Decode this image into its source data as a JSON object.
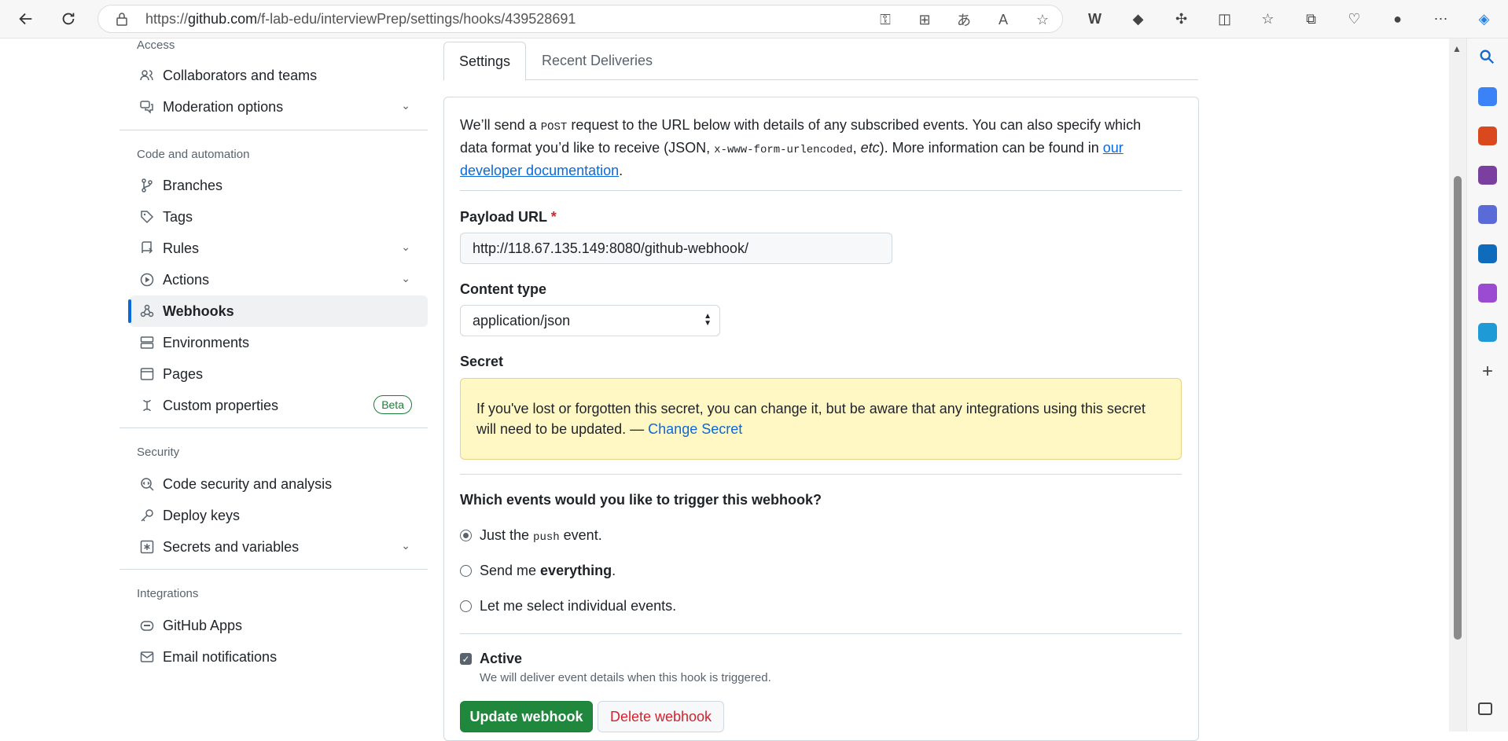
{
  "browser": {
    "url_prefix": "https://",
    "url_host": "github.com",
    "url_path": "/f-lab-edu/interviewPrep/settings/hooks/439528691"
  },
  "sidebar": {
    "access_heading": "Access",
    "access_items": [
      {
        "label": "Collaborators and teams",
        "icon": "people-icon"
      },
      {
        "label": "Moderation options",
        "icon": "comment-discussion-icon"
      }
    ],
    "code_heading": "Code and automation",
    "code_items": [
      {
        "label": "Branches",
        "icon": "git-branch-icon"
      },
      {
        "label": "Tags",
        "icon": "tag-icon"
      },
      {
        "label": "Rules",
        "icon": "repo-push-icon"
      },
      {
        "label": "Actions",
        "icon": "play-icon"
      },
      {
        "label": "Webhooks",
        "icon": "webhook-icon"
      },
      {
        "label": "Environments",
        "icon": "server-icon"
      },
      {
        "label": "Pages",
        "icon": "browser-icon"
      },
      {
        "label": "Custom properties",
        "icon": "note-icon",
        "badge": "Beta"
      }
    ],
    "security_heading": "Security",
    "security_items": [
      {
        "label": "Code security and analysis",
        "icon": "codescan-icon"
      },
      {
        "label": "Deploy keys",
        "icon": "key-icon"
      },
      {
        "label": "Secrets and variables",
        "icon": "key-asterisk-icon"
      }
    ],
    "integrations_heading": "Integrations",
    "integrations_items": [
      {
        "label": "GitHub Apps",
        "icon": "hubot-icon"
      },
      {
        "label": "Email notifications",
        "icon": "mail-icon"
      }
    ]
  },
  "tabs": {
    "settings": "Settings",
    "deliveries": "Recent Deliveries"
  },
  "form": {
    "intro_1": "We’ll send a ",
    "intro_post": "POST",
    "intro_2": " request to the URL below with details of any subscribed events. You can also specify which data format you’d like to receive (JSON, ",
    "intro_code": "x-www-form-urlencoded",
    "intro_3": ", ",
    "intro_etc": "etc",
    "intro_4": "). More information can be found in ",
    "intro_link": "our developer documentation",
    "intro_5": ".",
    "payload_label": "Payload URL",
    "payload_required": "*",
    "payload_value": "http://118.67.135.149:8080/github-webhook/",
    "content_type_label": "Content type",
    "content_type_value": "application/json",
    "secret_label": "Secret",
    "secret_notice": "If you've lost or forgotten this secret, you can change it, but be aware that any integrations using this secret will need to be updated. — ",
    "secret_link": "Change Secret",
    "events_question": "Which events would you like to trigger this webhook?",
    "event_push_1": "Just the ",
    "event_push_code": "push",
    "event_push_2": " event.",
    "event_all_1": "Send me ",
    "event_all_bold": "everything",
    "event_all_2": ".",
    "event_select": "Let me select individual events.",
    "active_label": "Active",
    "active_note": "We will deliver event details when this hook is triggered.",
    "update_button": "Update webhook",
    "delete_button": "Delete webhook"
  }
}
